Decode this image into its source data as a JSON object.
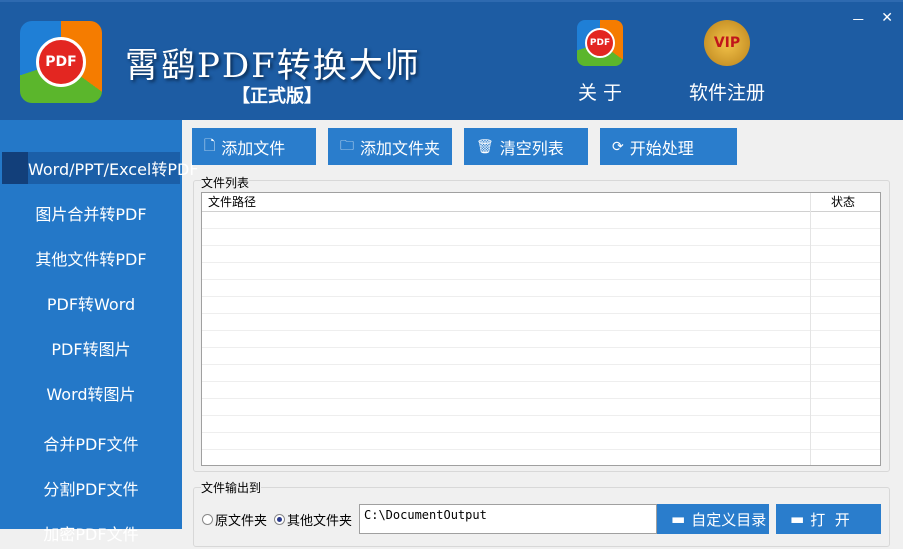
{
  "header": {
    "logo_text": "PDF",
    "title": "霄鹞PDF转换大师",
    "edition": "【正式版】",
    "about_label": "关 于",
    "about_icon_text": "PDF",
    "register_label": "软件注册",
    "register_icon_text": "VIP",
    "minimize": "－",
    "close": "✕"
  },
  "sidebar": {
    "items": [
      {
        "label": "Word/PPT/Excel转PDF"
      },
      {
        "label": "图片合并转PDF"
      },
      {
        "label": "其他文件转PDF"
      },
      {
        "label": "PDF转Word"
      },
      {
        "label": "PDF转图片"
      },
      {
        "label": "Word转图片"
      },
      {
        "label": "合并PDF文件"
      },
      {
        "label": "分割PDF文件"
      },
      {
        "label": "加密PDF文件"
      }
    ]
  },
  "toolbar": {
    "add_file": "添加文件",
    "add_folder": "添加文件夹",
    "clear_list": "清空列表",
    "start": "开始处理"
  },
  "file_list": {
    "group_label": "文件列表",
    "columns": [
      "文件路径",
      "状态"
    ],
    "rows": []
  },
  "output": {
    "group_label": "文件输出到",
    "radio_original": "原文件夹",
    "radio_other": "其他文件夹",
    "selected": "其他文件夹",
    "path": "C:\\DocumentOutput",
    "custom_dir": "自定义目录",
    "open": "打  开"
  }
}
